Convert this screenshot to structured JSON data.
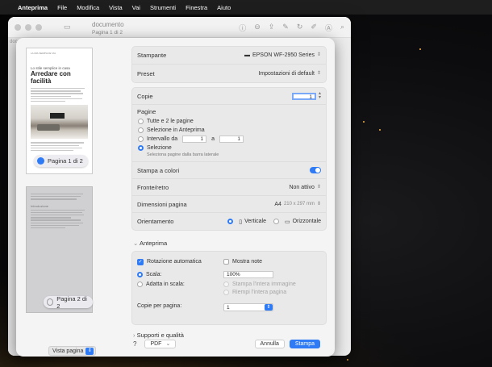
{
  "menubar": {
    "app": "Anteprima",
    "items": [
      "File",
      "Modifica",
      "Vista",
      "Vai",
      "Strumenti",
      "Finestra",
      "Aiuto"
    ]
  },
  "window": {
    "title": "documento",
    "subtitle": "Pagina 1 di 2",
    "sidebar_stub": "doc"
  },
  "thumbnails": {
    "page1": {
      "header": "LA MIA SEMPLICE VIA",
      "kicker": "Lo stile semplice in casa",
      "title": "Arredare con facilità",
      "label": "Pagina 1 di 2"
    },
    "page2": {
      "section": "Introduzione",
      "label": "Pagina 2 di 2"
    }
  },
  "view_selector": "Vista pagina",
  "printer": {
    "label": "Stampante",
    "value": "EPSON WF-2950 Series"
  },
  "preset": {
    "label": "Preset",
    "value": "Impostazioni di default"
  },
  "copies": {
    "label": "Copie",
    "value": "1"
  },
  "pages": {
    "label": "Pagine",
    "all": "Tutte e 2 le pagine",
    "selection_preview": "Selezione in Anteprima",
    "range": "Intervallo da",
    "from": "1",
    "to_label": "a",
    "to": "1",
    "selection": "Selezione",
    "selection_hint": "Seleziona pagine dalla barra laterale"
  },
  "color": {
    "label": "Stampa a colori"
  },
  "duplex": {
    "label": "Fronte/retro",
    "value": "Non attivo"
  },
  "paper": {
    "label": "Dimensioni pagina",
    "value": "A4",
    "dims": "210 x 297 mm"
  },
  "orientation": {
    "label": "Orientamento",
    "portrait": "Verticale",
    "landscape": "Orizzontale"
  },
  "preview": {
    "section": "Anteprima",
    "auto_rotate": "Rotazione automatica",
    "show_notes": "Mostra note",
    "scale": "Scala:",
    "scale_value": "100%",
    "fit": "Adatta in scala:",
    "print_entire": "Stampa l'intera immagine",
    "fill_entire": "Riempi l'intera pagina",
    "pages_per_sheet": "Copie per pagina:",
    "pages_per_sheet_value": "1"
  },
  "supports": {
    "label": "Supporti e qualità"
  },
  "footer": {
    "help": "?",
    "pdf": "PDF",
    "cancel": "Annulla",
    "print": "Stampa"
  },
  "colors": {
    "accent": "#2f7bf5"
  }
}
